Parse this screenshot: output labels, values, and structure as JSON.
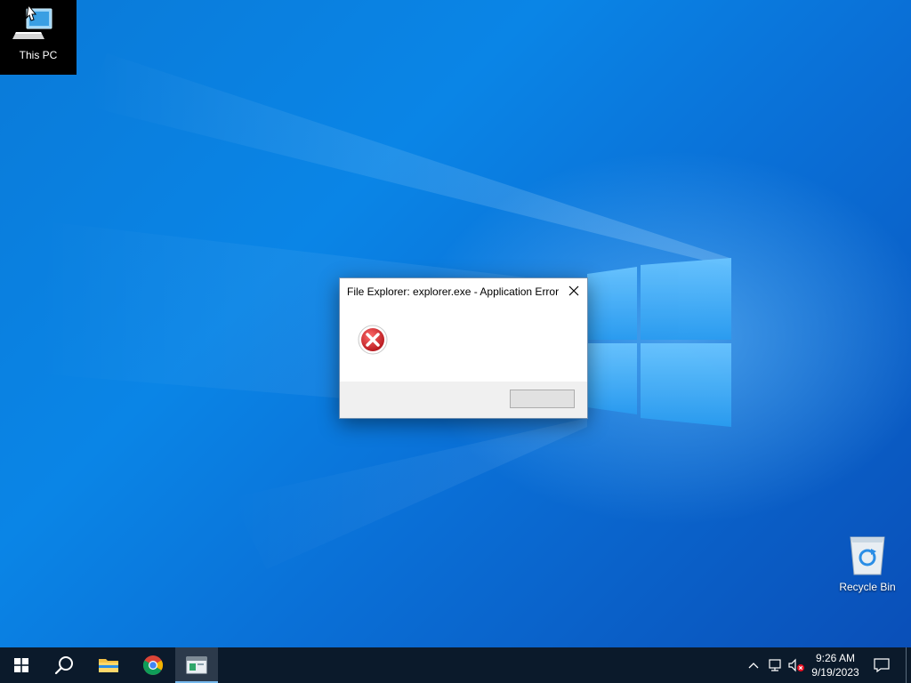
{
  "desktop": {
    "icons": [
      {
        "label": "This PC"
      },
      {
        "label": "Recycle Bin"
      }
    ]
  },
  "dialog": {
    "title": "File Explorer: explorer.exe - Application Error",
    "ok_label": ""
  },
  "taskbar": {
    "buttons": [
      "start",
      "search",
      "file-explorer",
      "chrome",
      "active-app"
    ],
    "active_button": "active-app"
  },
  "tray": {
    "time": "9:26 AM",
    "date": "9/19/2023"
  },
  "colors": {
    "desktop_blue": "#0a7ad8",
    "taskbar": "#0b1a2b",
    "error_red": "#d8262d"
  }
}
